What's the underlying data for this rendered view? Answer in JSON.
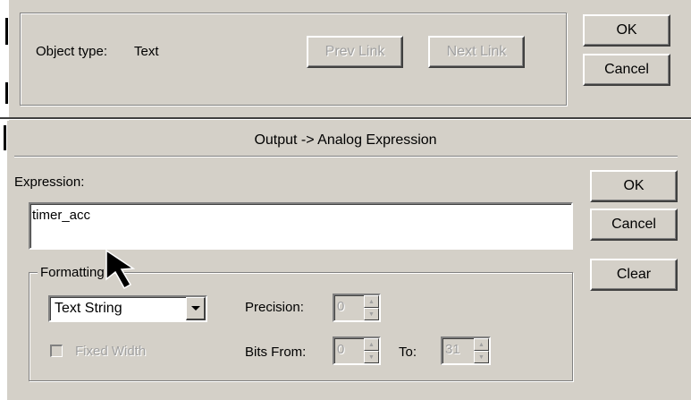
{
  "top": {
    "object_type_label": "Object type:",
    "object_type_value": "Text",
    "prev_link": "Prev Link",
    "next_link": "Next Link",
    "ok": "OK",
    "cancel": "Cancel"
  },
  "dialog": {
    "title": "Output -> Analog Expression",
    "expression_label": "Expression:",
    "expression_value": "timer_acc",
    "ok": "OK",
    "cancel": "Cancel",
    "clear": "Clear",
    "formatting": {
      "group_label": "Formatting",
      "format_selected": "Text String",
      "precision_label": "Precision:",
      "precision_value": "0",
      "fixed_width_label": "Fixed Width",
      "fixed_width_checked": false,
      "bits_from_label": "Bits From:",
      "bits_from_value": "0",
      "to_label": "To:",
      "to_value": "31"
    }
  },
  "icons": {
    "dropdown": "chevron-down-icon",
    "cursor": "mouse-pointer-icon",
    "spin_up": "spin-up-icon",
    "spin_down": "spin-down-icon"
  }
}
